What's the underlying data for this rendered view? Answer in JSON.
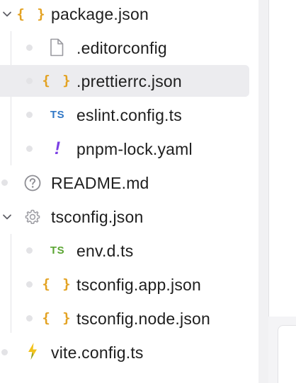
{
  "explorer": {
    "items": [
      {
        "label": "package.json",
        "icon": "json-braces-icon",
        "expanded": true
      },
      {
        "label": ".editorconfig",
        "icon": "file-icon"
      },
      {
        "label": ".prettierrc.json",
        "icon": "json-braces-icon",
        "selected": true
      },
      {
        "label": "eslint.config.ts",
        "icon": "typescript-icon",
        "icon_text": "TS"
      },
      {
        "label": "pnpm-lock.yaml",
        "icon": "yaml-exclamation-icon",
        "icon_text": "!"
      },
      {
        "label": "README.md",
        "icon": "help-circle-icon"
      },
      {
        "label": "tsconfig.json",
        "icon": "gear-icon",
        "expanded": true
      },
      {
        "label": "env.d.ts",
        "icon": "typescript-icon",
        "icon_text": "TS"
      },
      {
        "label": "tsconfig.app.json",
        "icon": "json-braces-icon"
      },
      {
        "label": "tsconfig.node.json",
        "icon": "json-braces-icon"
      },
      {
        "label": "vite.config.ts",
        "icon": "vite-bolt-icon"
      }
    ]
  },
  "icons": {
    "braces_text": "{ }"
  },
  "colors": {
    "json_braces": "#e3a222",
    "ts_blue": "#3178c6",
    "ts_green": "#5aa532",
    "yaml_purple": "#7b3fe4",
    "vite_yellow": "#f2c21b",
    "vite_dark": "#8aa02a",
    "selection_bg": "#ececef",
    "text": "#1e1e1e",
    "muted_icon": "#9a9aa0"
  }
}
